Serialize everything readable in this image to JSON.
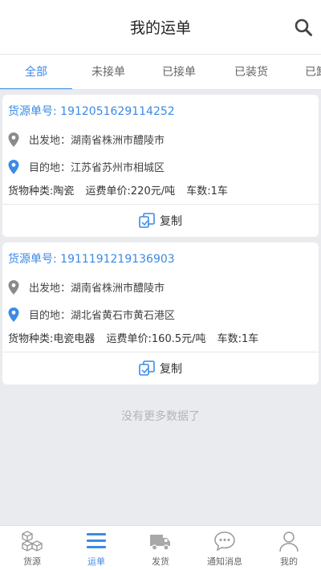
{
  "header": {
    "title": "我的运单"
  },
  "tabs": [
    "全部",
    "未接单",
    "已接单",
    "已装货",
    "已卸货"
  ],
  "active_tab": 0,
  "orders": [
    {
      "number": "货源单号: 1912051629114252",
      "origin": "出发地：湖南省株洲市醴陵市",
      "destination": "目的地：江苏省苏州市相城区",
      "cargo": "货物种类:陶瓷",
      "price": "运费单价:220元/吨",
      "trucks": "车数:1车",
      "copy": "复制"
    },
    {
      "number": "货源单号: 1911191219136903",
      "origin": "出发地：湖南省株洲市醴陵市",
      "destination": "目的地：湖北省黄石市黄石港区",
      "cargo": "货物种类:电瓷电器",
      "price": "运费单价:160.5元/吨",
      "trucks": "车数:1车",
      "copy": "复制"
    }
  ],
  "no_more": "没有更多数据了",
  "nav": [
    {
      "label": "货源",
      "icon": "cubes-icon"
    },
    {
      "label": "运单",
      "icon": "list-icon"
    },
    {
      "label": "发货",
      "icon": "truck-icon"
    },
    {
      "label": "通知消息",
      "icon": "chat-icon"
    },
    {
      "label": "我的",
      "icon": "user-icon"
    }
  ],
  "active_nav": 1,
  "colors": {
    "accent": "#3b8ae6",
    "gray_icon": "#9a9a9a",
    "background": "#e9ebef"
  }
}
